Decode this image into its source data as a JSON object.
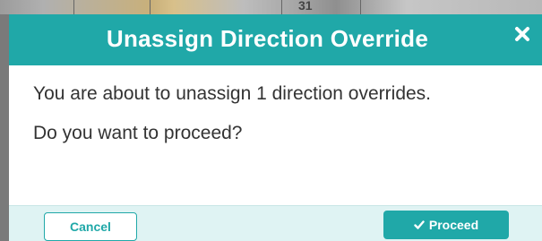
{
  "background": {
    "partial_text": "31"
  },
  "dialog": {
    "title": "Unassign Direction Override",
    "close_icon": "close-icon",
    "message_line1": "You are about to unassign 1 direction overrides.",
    "message_line2": "Do you want to proceed?",
    "buttons": {
      "cancel_label": "Cancel",
      "proceed_label": "Proceed",
      "proceed_icon": "check-icon"
    }
  },
  "colors": {
    "accent": "#20a8a8",
    "footer_bg": "#dff3f3",
    "text": "#333333"
  }
}
